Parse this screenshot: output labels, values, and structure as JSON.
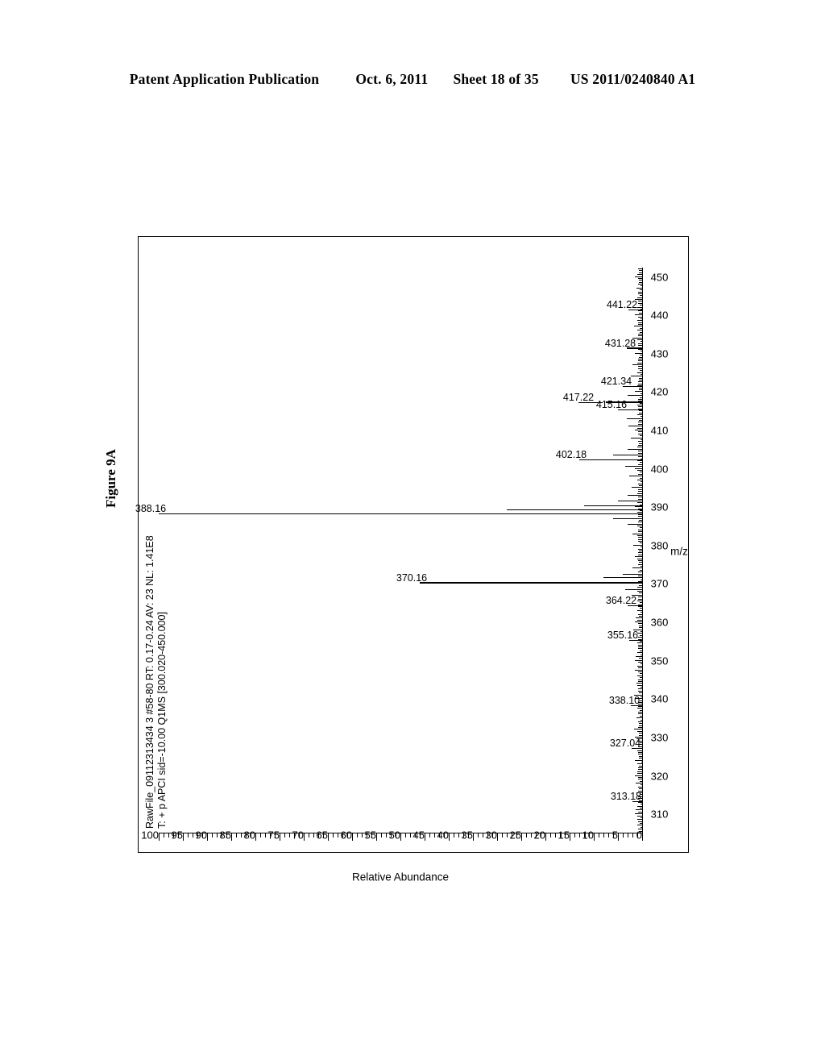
{
  "page_header": {
    "publication": "Patent Application Publication",
    "date": "Oct. 6, 2011",
    "sheet": "Sheet 18 of 35",
    "document_number": "US 2011/0240840 A1"
  },
  "figure": {
    "label": "Figure 9A"
  },
  "annotation": {
    "line1": "RawFile_09112313434 3 #58-80  RT: 0.17-0.24  AV: 23  NL: 1.41E8",
    "line2": "T: + p APCI sid=-10.00  Q1MS [300.020-450.000]"
  },
  "chart_data": {
    "type": "line",
    "title": "Figure 9A",
    "subtitle": "RawFile_09112313434 3 #58-80  RT: 0.17-0.24  AV: 23  NL: 1.41E8",
    "xlabel": "m/z",
    "ylabel": "Relative Abundance",
    "xlim": [
      305,
      452
    ],
    "ylim": [
      0,
      100
    ],
    "grid": false,
    "legend": "none",
    "orientation": "rotated-90",
    "x_ticks_major": [
      310,
      320,
      330,
      340,
      350,
      360,
      370,
      380,
      390,
      400,
      410,
      420,
      430,
      440,
      450
    ],
    "x_tick_minor_step": 2,
    "y_ticks_major": [
      0,
      5,
      10,
      15,
      20,
      25,
      30,
      35,
      40,
      45,
      50,
      55,
      60,
      65,
      70,
      75,
      80,
      85,
      90,
      95,
      100
    ],
    "y_tick_minor_step": 1,
    "labeled_peaks": [
      {
        "mz": 313.18,
        "label": "313.18",
        "intensity": 2.0
      },
      {
        "mz": 327.04,
        "label": "327.04",
        "intensity": 2.2
      },
      {
        "mz": 338.1,
        "label": "338.10",
        "intensity": 2.4
      },
      {
        "mz": 355.16,
        "label": "355.16",
        "intensity": 2.6
      },
      {
        "mz": 364.22,
        "label": "364.22",
        "intensity": 3.0
      },
      {
        "mz": 370.16,
        "label": "370.16",
        "intensity": 46.0
      },
      {
        "mz": 388.16,
        "label": "388.16",
        "intensity": 100.0
      },
      {
        "mz": 402.18,
        "label": "402.18",
        "intensity": 13.0
      },
      {
        "mz": 415.16,
        "label": "415.16",
        "intensity": 5.0
      },
      {
        "mz": 417.22,
        "label": "417.22",
        "intensity": 7.5
      },
      {
        "mz": 421.34,
        "label": "421.34",
        "intensity": 4.0
      },
      {
        "mz": 431.28,
        "label": "431.28",
        "intensity": 3.2
      },
      {
        "mz": 441.22,
        "label": "441.22",
        "intensity": 2.8
      }
    ],
    "minor_peaks": [
      {
        "mz": 308.5,
        "intensity": 1.0
      },
      {
        "mz": 311.0,
        "intensity": 1.3
      },
      {
        "mz": 315.5,
        "intensity": 1.1
      },
      {
        "mz": 318.0,
        "intensity": 1.4
      },
      {
        "mz": 321.0,
        "intensity": 1.0
      },
      {
        "mz": 324.0,
        "intensity": 1.5
      },
      {
        "mz": 329.5,
        "intensity": 1.2
      },
      {
        "mz": 332.0,
        "intensity": 1.6
      },
      {
        "mz": 335.0,
        "intensity": 1.1
      },
      {
        "mz": 341.0,
        "intensity": 1.7
      },
      {
        "mz": 344.0,
        "intensity": 1.2
      },
      {
        "mz": 347.5,
        "intensity": 1.5
      },
      {
        "mz": 351.0,
        "intensity": 1.3
      },
      {
        "mz": 358.0,
        "intensity": 1.9
      },
      {
        "mz": 361.0,
        "intensity": 1.4
      },
      {
        "mz": 367.0,
        "intensity": 2.2
      },
      {
        "mz": 368.5,
        "intensity": 3.5
      },
      {
        "mz": 371.5,
        "intensity": 8.0
      },
      {
        "mz": 372.5,
        "intensity": 4.0
      },
      {
        "mz": 374.0,
        "intensity": 2.0
      },
      {
        "mz": 377.0,
        "intensity": 1.5
      },
      {
        "mz": 380.0,
        "intensity": 1.8
      },
      {
        "mz": 383.0,
        "intensity": 2.0
      },
      {
        "mz": 385.5,
        "intensity": 3.0
      },
      {
        "mz": 387.0,
        "intensity": 6.0
      },
      {
        "mz": 389.2,
        "intensity": 28.0
      },
      {
        "mz": 390.2,
        "intensity": 12.0
      },
      {
        "mz": 391.5,
        "intensity": 5.0
      },
      {
        "mz": 393.0,
        "intensity": 3.0
      },
      {
        "mz": 395.0,
        "intensity": 2.2
      },
      {
        "mz": 398.0,
        "intensity": 2.6
      },
      {
        "mz": 400.5,
        "intensity": 3.5
      },
      {
        "mz": 403.5,
        "intensity": 6.0
      },
      {
        "mz": 405.0,
        "intensity": 3.0
      },
      {
        "mz": 408.0,
        "intensity": 2.4
      },
      {
        "mz": 411.0,
        "intensity": 2.8
      },
      {
        "mz": 413.0,
        "intensity": 3.2
      },
      {
        "mz": 419.0,
        "intensity": 3.0
      },
      {
        "mz": 424.0,
        "intensity": 2.4
      },
      {
        "mz": 427.0,
        "intensity": 2.0
      },
      {
        "mz": 434.0,
        "intensity": 2.0
      },
      {
        "mz": 437.0,
        "intensity": 1.7
      },
      {
        "mz": 444.0,
        "intensity": 1.5
      },
      {
        "mz": 447.0,
        "intensity": 1.2
      }
    ]
  }
}
